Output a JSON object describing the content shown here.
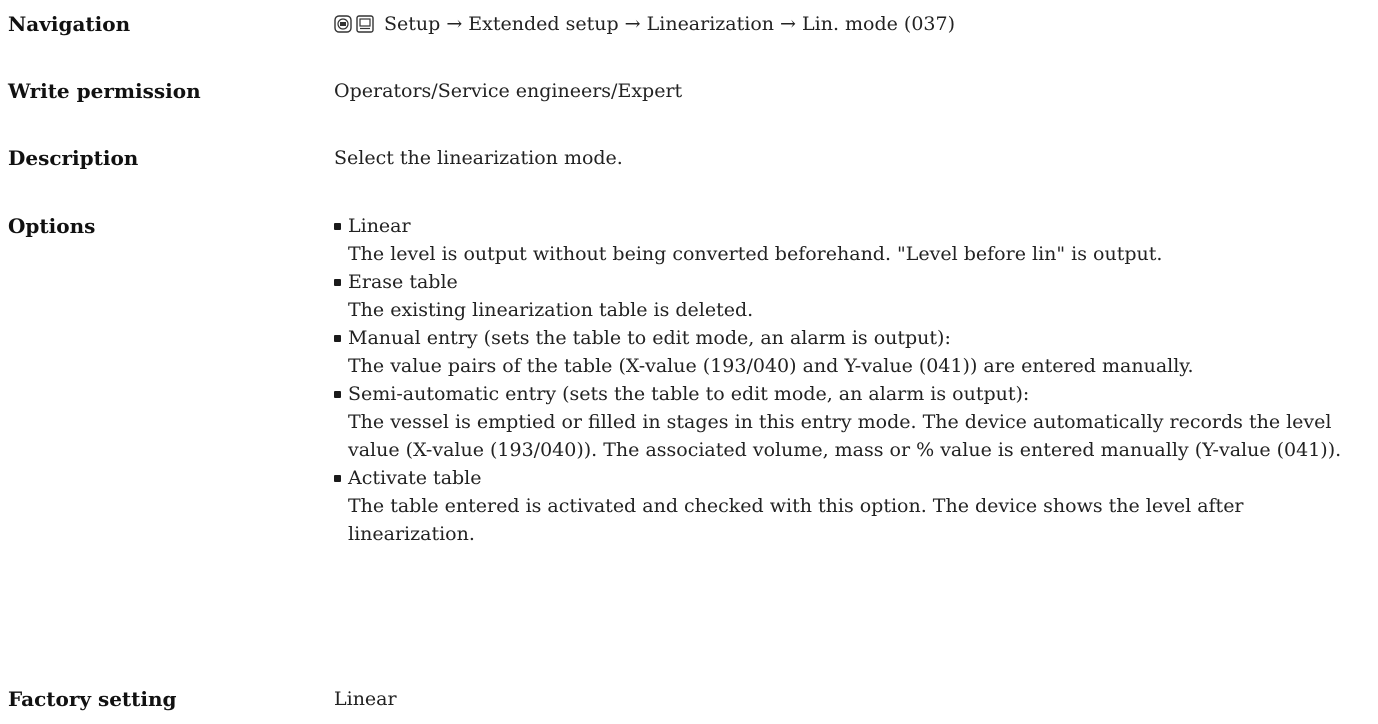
{
  "navigation": {
    "label": "Navigation",
    "path": "Setup → Extended setup → Linearization → Lin. mode (037)"
  },
  "write_permission": {
    "label": "Write permission",
    "value": "Operators/Service engineers/Expert"
  },
  "description": {
    "label": "Description",
    "value": "Select the linearization mode."
  },
  "options": {
    "label": "Options",
    "items": [
      {
        "title": "Linear",
        "desc": "The level is output without being converted beforehand. \"Level before lin\" is output."
      },
      {
        "title": "Erase table",
        "desc": "The existing linearization table is deleted."
      },
      {
        "title": "Manual entry (sets the table to edit mode, an alarm is output):",
        "desc": "The value pairs of the table (X-value (193/040) and Y-value (041)) are entered manually."
      },
      {
        "title": "Semi-automatic entry (sets the table to edit mode, an alarm is output):",
        "desc": "The vessel is emptied or filled in stages in this entry mode. The device automatically records the level value (X-value (193/040)). The associated volume, mass or % value is entered manually (Y-value (041))."
      },
      {
        "title": "Activate table",
        "desc": "The table entered is activated and checked with this option. The device shows the level after linearization."
      }
    ]
  },
  "factory_setting": {
    "label": "Factory setting",
    "value": "Linear"
  },
  "icons": [
    "display-operating-icon",
    "display-module-icon"
  ]
}
